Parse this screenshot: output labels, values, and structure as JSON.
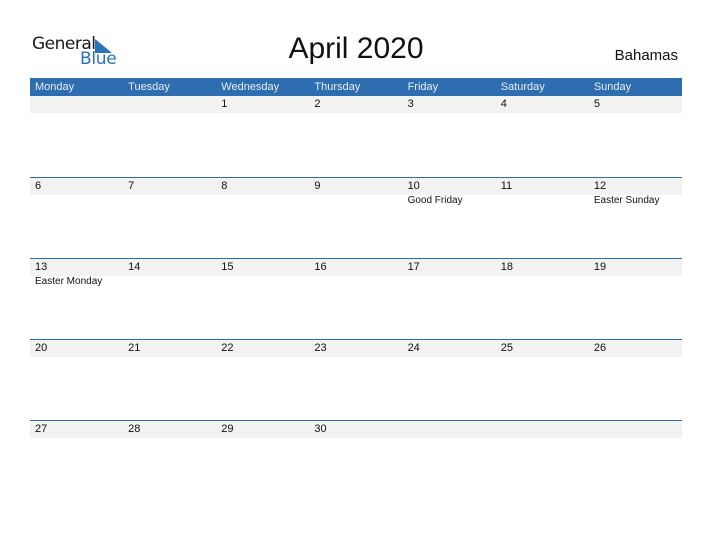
{
  "logo": {
    "word1": "General",
    "word2": "Blue",
    "icon": "triangle-flag-icon",
    "brand_color": "#2a73b8"
  },
  "title": "April 2020",
  "country": "Bahamas",
  "colors": {
    "header_bg": "#2e6db0",
    "stripe_bg": "#f2f2f2"
  },
  "weekdays": [
    "Monday",
    "Tuesday",
    "Wednesday",
    "Thursday",
    "Friday",
    "Saturday",
    "Sunday"
  ],
  "weeks": [
    [
      {
        "day": "",
        "holiday": ""
      },
      {
        "day": "",
        "holiday": ""
      },
      {
        "day": "1",
        "holiday": ""
      },
      {
        "day": "2",
        "holiday": ""
      },
      {
        "day": "3",
        "holiday": ""
      },
      {
        "day": "4",
        "holiday": ""
      },
      {
        "day": "5",
        "holiday": ""
      }
    ],
    [
      {
        "day": "6",
        "holiday": ""
      },
      {
        "day": "7",
        "holiday": ""
      },
      {
        "day": "8",
        "holiday": ""
      },
      {
        "day": "9",
        "holiday": ""
      },
      {
        "day": "10",
        "holiday": "Good Friday"
      },
      {
        "day": "11",
        "holiday": ""
      },
      {
        "day": "12",
        "holiday": "Easter Sunday"
      }
    ],
    [
      {
        "day": "13",
        "holiday": "Easter Monday"
      },
      {
        "day": "14",
        "holiday": ""
      },
      {
        "day": "15",
        "holiday": ""
      },
      {
        "day": "16",
        "holiday": ""
      },
      {
        "day": "17",
        "holiday": ""
      },
      {
        "day": "18",
        "holiday": ""
      },
      {
        "day": "19",
        "holiday": ""
      }
    ],
    [
      {
        "day": "20",
        "holiday": ""
      },
      {
        "day": "21",
        "holiday": ""
      },
      {
        "day": "22",
        "holiday": ""
      },
      {
        "day": "23",
        "holiday": ""
      },
      {
        "day": "24",
        "holiday": ""
      },
      {
        "day": "25",
        "holiday": ""
      },
      {
        "day": "26",
        "holiday": ""
      }
    ],
    [
      {
        "day": "27",
        "holiday": ""
      },
      {
        "day": "28",
        "holiday": ""
      },
      {
        "day": "29",
        "holiday": ""
      },
      {
        "day": "30",
        "holiday": ""
      },
      {
        "day": "",
        "holiday": ""
      },
      {
        "day": "",
        "holiday": ""
      },
      {
        "day": "",
        "holiday": ""
      }
    ]
  ]
}
